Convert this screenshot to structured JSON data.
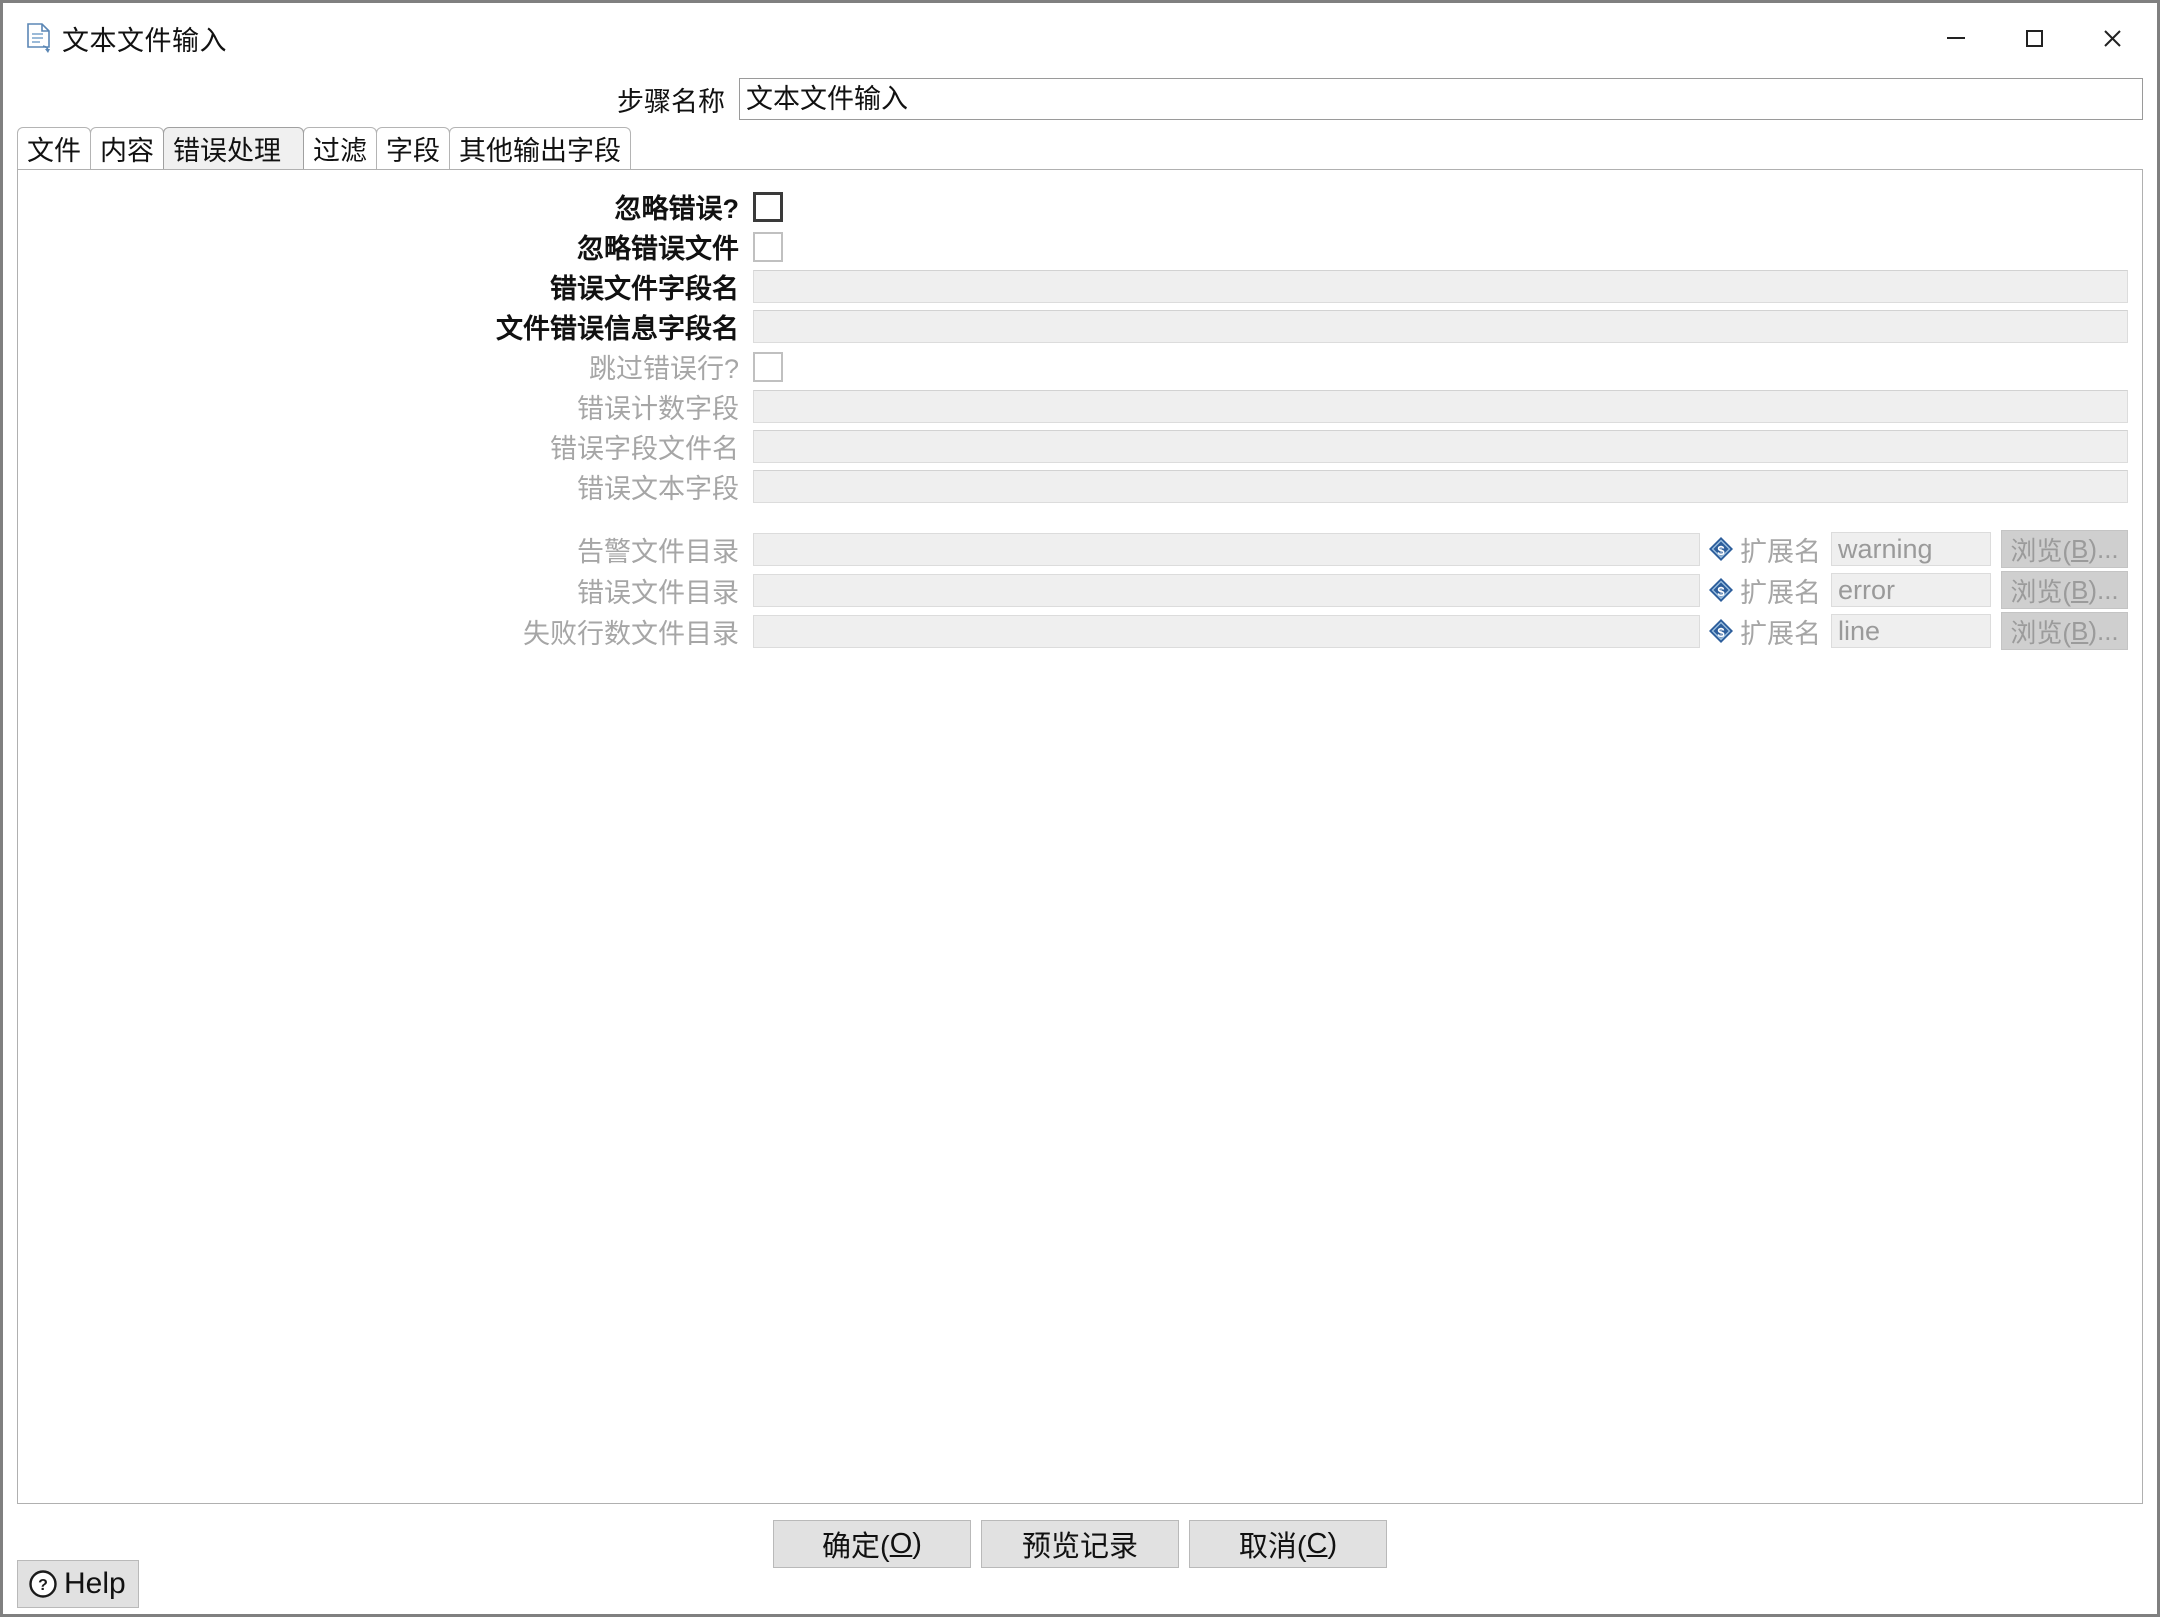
{
  "window": {
    "title": "文本文件输入",
    "title_icon": "text-file-input-icon",
    "controls": {
      "minimize": "minimize-icon",
      "maximize": "maximize-icon",
      "close": "close-icon"
    }
  },
  "stepname": {
    "label": "步骤名称",
    "value": "文本文件输入"
  },
  "tabs": [
    {
      "label": "文件",
      "selected": false
    },
    {
      "label": "内容",
      "selected": false
    },
    {
      "label": "错误处理",
      "selected": true
    },
    {
      "label": "过滤",
      "selected": false
    },
    {
      "label": "字段",
      "selected": false
    },
    {
      "label": "其他输出字段",
      "selected": false
    }
  ],
  "form": {
    "rows": [
      {
        "label": "忽略错误?",
        "type": "checkbox",
        "checked": false,
        "disabled": false,
        "bold": true
      },
      {
        "label": "忽略错误文件",
        "type": "checkbox",
        "checked": false,
        "disabled": true,
        "bold": true
      },
      {
        "label": "错误文件字段名",
        "type": "text",
        "value": "",
        "disabled": true,
        "bold": true
      },
      {
        "label": "文件错误信息字段名",
        "type": "text",
        "value": "",
        "disabled": true,
        "bold": true
      },
      {
        "label": "跳过错误行?",
        "type": "checkbox",
        "checked": false,
        "disabled": true,
        "bold": false
      },
      {
        "label": "错误计数字段",
        "type": "text",
        "value": "",
        "disabled": true,
        "bold": false
      },
      {
        "label": "错误字段文件名",
        "type": "text",
        "value": "",
        "disabled": true,
        "bold": false
      },
      {
        "label": "错误文本字段",
        "type": "text",
        "value": "",
        "disabled": true,
        "bold": false
      }
    ],
    "dir_rows": [
      {
        "label": "告警文件目录",
        "path_value": "",
        "var_icon": "variable-dollar-icon",
        "ext_label": "扩展名",
        "ext_value": "warning",
        "browse_label": "浏览(B)...",
        "browse_mnemonic": "B"
      },
      {
        "label": "错误文件目录",
        "path_value": "",
        "var_icon": "variable-dollar-icon",
        "ext_label": "扩展名",
        "ext_value": "error",
        "browse_label": "浏览(B)...",
        "browse_mnemonic": "B"
      },
      {
        "label": "失败行数文件目录",
        "path_value": "",
        "var_icon": "variable-dollar-icon",
        "ext_label": "扩展名",
        "ext_value": "line",
        "browse_label": "浏览(B)...",
        "browse_mnemonic": "B"
      }
    ]
  },
  "footer": {
    "ok_label": "确定(O)",
    "ok_mnemonic": "O",
    "preview_label": "预览记录",
    "cancel_label": "取消(C)",
    "cancel_mnemonic": "C",
    "help_label": "Help",
    "help_icon": "question-circle-icon"
  },
  "colors": {
    "window_border": "#808080",
    "tab_selected_bg": "#f0f0f0",
    "input_disabled_bg": "#efefef",
    "button_bg": "#e1e1e1",
    "browse_button_bg": "#cfcfcf",
    "disabled_text": "#a6a6a6",
    "variable_icon_blue": "#2c5d9b"
  }
}
